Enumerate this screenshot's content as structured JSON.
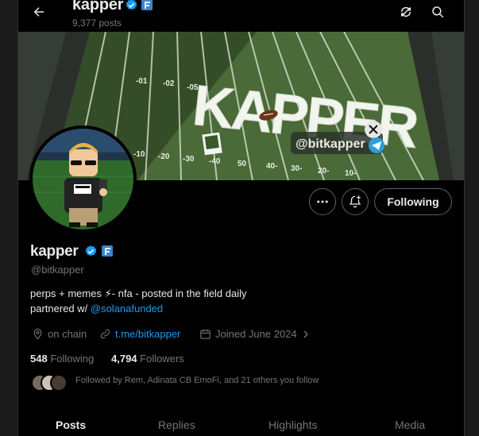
{
  "header": {
    "name": "kapper",
    "posts": "9,377 posts",
    "back_icon": "arrow-left-icon",
    "actions": [
      "refresh-icon",
      "search-icon"
    ]
  },
  "banner": {
    "text_big": "KAPPER",
    "handle": "@bitkapper",
    "yard_numbers_top": [
      "-01",
      "-02",
      "-05"
    ],
    "yard_numbers_bottom": [
      "-10",
      "-20",
      "-30",
      "-40",
      "50",
      "40-",
      "30-",
      "20-",
      "10-"
    ]
  },
  "actions": {
    "more_icon": "more-horizontal-icon",
    "notify_icon": "bell-plus-icon",
    "follow_label": "Following"
  },
  "profile": {
    "name": "kapper",
    "handle": "@bitkapper",
    "bio_line1": "perps + memes ⚡- nfa - posted in the field daily",
    "bio_line2_prefix": "partnered w/ ",
    "bio_line2_link": "@solanafunded",
    "location": "on chain",
    "website": "t.me/bitkapper",
    "joined": "Joined June 2024",
    "following_count": "548",
    "following_label": "Following",
    "followers_count": "4,794",
    "followers_label": "Followers",
    "followed_by": "Followed by Rem, Adinata CB EmoFi, and 21 others you follow"
  },
  "tabs": [
    "Posts",
    "Replies",
    "Highlights",
    "Media"
  ],
  "colors": {
    "accent": "#1d9bf0",
    "verified": "#1d9bf0",
    "secondary_text": "#71767b"
  }
}
